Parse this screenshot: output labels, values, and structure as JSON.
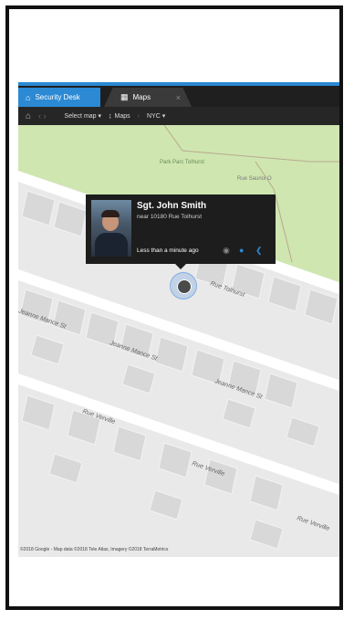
{
  "tabs": [
    {
      "label": "Security Desk",
      "icon": "home-icon",
      "active": true
    },
    {
      "label": "Maps",
      "icon": "map-icon",
      "closable": true
    }
  ],
  "toolbar": {
    "select_map": "Select map ▾",
    "maps_label": "Maps",
    "current_map": "NYC ▾"
  },
  "map": {
    "park_label": "Park Parc Tolhurst",
    "streets": [
      "Rue Sauriol O",
      "Rue Tolhurst",
      "Jeanne Mance St",
      "Jeanne Mance St",
      "Jeanne Mance St",
      "Rue Verville",
      "Rue Verville",
      "Rue Verville"
    ],
    "attribution": "©2018 Google - Map data ©2018 Tele Atlas, Imagery ©2018 TerraMetrics"
  },
  "popup": {
    "name": "Sgt. John Smith",
    "location": "near 10180 Rue Tolhurst",
    "time": "Less than a minute ago"
  },
  "colors": {
    "accent": "#2c89d3",
    "park": "#cfe6b0",
    "popup_bg": "#1d1d1d"
  }
}
